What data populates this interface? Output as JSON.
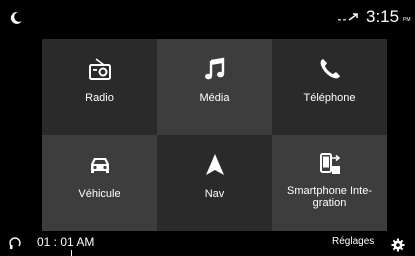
{
  "status_bar": {
    "night_mode_icon": "moon-icon",
    "signal_icon": "signal-icon",
    "time": "3:15",
    "ampm": "PM"
  },
  "tiles": [
    {
      "label": "Radio",
      "icon": "radio-icon"
    },
    {
      "label": "Média",
      "icon": "music-note-icon"
    },
    {
      "label": "Téléphone",
      "icon": "phone-icon"
    },
    {
      "label": "Véhicule",
      "icon": "car-icon"
    },
    {
      "label": "Nav",
      "icon": "navigation-arrow-icon"
    },
    {
      "label": "Smartphone Inte-\ngration",
      "icon": "smartphone-projection-icon"
    }
  ],
  "bottom_bar": {
    "time": "01 : 01 AM",
    "settings_label": "Réglages",
    "settings_icon": "gear-icon",
    "bluetooth_icon": "bluetooth-audio-icon"
  },
  "colors": {
    "background": "#000000",
    "tile_dark": "#2a2a2a",
    "tile_light": "#3d3d3d",
    "text": "#ffffff"
  }
}
